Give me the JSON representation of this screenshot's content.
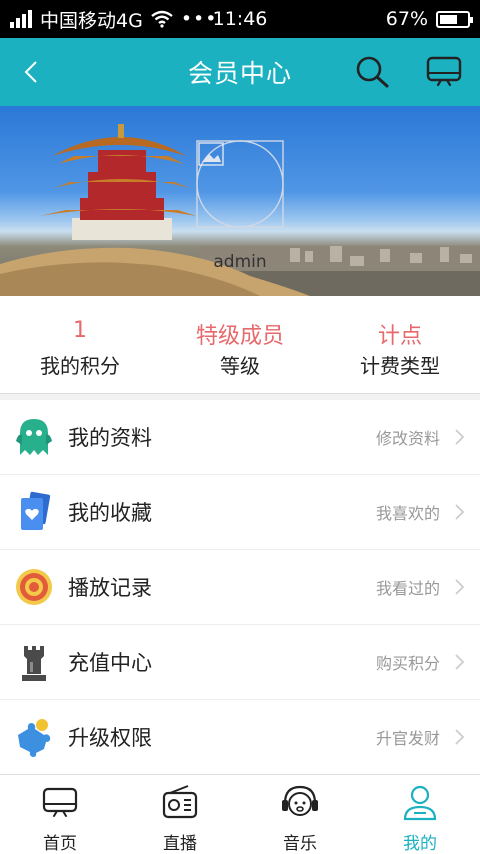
{
  "status": {
    "carrier": "中国移动4G",
    "time": "11:46",
    "battery_text": "67%",
    "battery_level": 0.67
  },
  "header": {
    "title": "会员中心",
    "back_icon": "back-arrow-icon",
    "search_icon": "search-icon",
    "tv_icon": "tv-icon",
    "color": "#1bb1c1"
  },
  "profile": {
    "username": "admin"
  },
  "stats": [
    {
      "value": "1",
      "label": "我的积分"
    },
    {
      "value": "特级成员",
      "label": "等级"
    },
    {
      "value": "计点",
      "label": "计费类型"
    }
  ],
  "menu": [
    {
      "label": "我的资料",
      "hint": "修改资料",
      "icon": "ghost-icon"
    },
    {
      "label": "我的收藏",
      "hint": "我喜欢的",
      "icon": "heart-card-icon"
    },
    {
      "label": "播放记录",
      "hint": "我看过的",
      "icon": "target-icon"
    },
    {
      "label": "充值中心",
      "hint": "购买积分",
      "icon": "rook-icon"
    },
    {
      "label": "升级权限",
      "hint": "升官发财",
      "icon": "puzzle-icon"
    }
  ],
  "tabs": [
    {
      "label": "首页",
      "icon": "tv-icon",
      "active": false
    },
    {
      "label": "直播",
      "icon": "radio-icon",
      "active": false
    },
    {
      "label": "音乐",
      "icon": "headphones-icon",
      "active": false
    },
    {
      "label": "我的",
      "icon": "user-icon",
      "active": true
    }
  ],
  "colors": {
    "accent": "#1bb1c1",
    "stat_value": "#e8696b"
  }
}
